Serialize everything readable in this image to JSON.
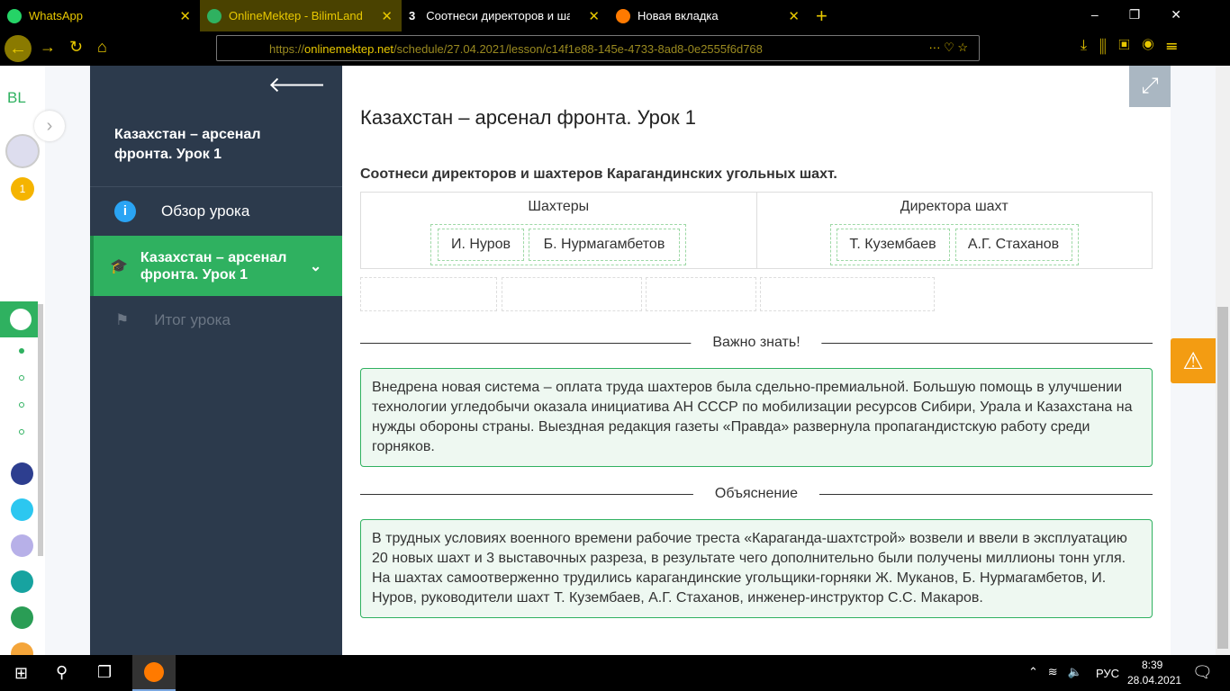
{
  "browser": {
    "tabs": [
      {
        "title": "WhatsApp"
      },
      {
        "title": "OnlineMektep - BilimLand"
      },
      {
        "title": "Соотнеси директоров и шахте"
      },
      {
        "title": "Новая вкладка"
      }
    ],
    "tab3_badge": "3",
    "url_prefix": "https://",
    "url_host": "onlinemektep.net",
    "url_path": "/schedule/27.04.2021/lesson/c14f1e88-145e-4733-8ad8-0e2555f6d768"
  },
  "leftbar": {
    "logo": "BL",
    "badge": "1"
  },
  "sidebar": {
    "title": "Казахстан – арсенал фронта. Урок 1",
    "items": [
      {
        "label": "Обзор урока"
      },
      {
        "label": "Казахстан – арсенал фронта. Урок 1"
      },
      {
        "label": "Итог урока"
      }
    ]
  },
  "main": {
    "title": "Казахстан – арсенал фронта. Урок 1",
    "question": "Соотнеси директоров и шахтеров Карагандинских угольных шахт.",
    "columns": [
      {
        "header": "Шахтеры",
        "items": [
          "И. Нуров",
          "Б. Нурмагамбетов"
        ]
      },
      {
        "header": "Директора шахт",
        "items": [
          "Т. Кузембаев",
          "А.Г. Стаханов"
        ]
      }
    ],
    "important_label": "Важно знать!",
    "important_text": "Внедрена новая система – оплата труда шахтеров была сдельно-премиальной. Большую помощь в улучшении технологии угледобычи оказала инициатива АН СССР по мобилизации ресурсов Сибири, Урала и Казахстана на нужды обороны страны. Выездная редакция газеты «Правда» развернула пропагандистскую работу среди горняков.",
    "explanation_label": "Объяснение",
    "explanation_text": "В трудных условиях военного времени рабочие треста «Караганда-шахтстрой» возвели и ввели в эксплуатацию 20 новых шахт и 3 выставочных разреза, в результате чего дополнительно были получены миллионы тонн угля. На шахтах самоотверженно трудились карагандинские угольщики-горняки Ж. Муканов, Б. Нурмагамбетов, И. Нуров, руководители шахт Т. Кузембаев, А.Г. Стаханов, инженер-инструктор С.С. Макаров."
  },
  "taskbar": {
    "lang": "РУС",
    "time": "8:39",
    "date": "28.04.2021"
  }
}
